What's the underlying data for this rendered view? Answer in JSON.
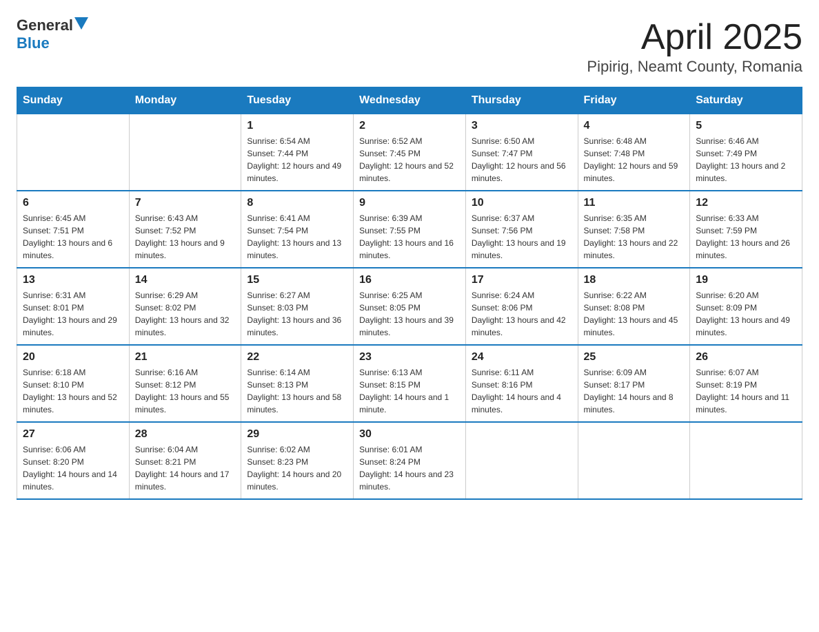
{
  "logo": {
    "text_general": "General",
    "text_blue": "Blue",
    "arrow": "▲"
  },
  "title": {
    "month_year": "April 2025",
    "location": "Pipirig, Neamt County, Romania"
  },
  "weekdays": [
    "Sunday",
    "Monday",
    "Tuesday",
    "Wednesday",
    "Thursday",
    "Friday",
    "Saturday"
  ],
  "weeks": [
    [
      {
        "day": "",
        "info": ""
      },
      {
        "day": "",
        "info": ""
      },
      {
        "day": "1",
        "info": "Sunrise: 6:54 AM\nSunset: 7:44 PM\nDaylight: 12 hours and 49 minutes."
      },
      {
        "day": "2",
        "info": "Sunrise: 6:52 AM\nSunset: 7:45 PM\nDaylight: 12 hours and 52 minutes."
      },
      {
        "day": "3",
        "info": "Sunrise: 6:50 AM\nSunset: 7:47 PM\nDaylight: 12 hours and 56 minutes."
      },
      {
        "day": "4",
        "info": "Sunrise: 6:48 AM\nSunset: 7:48 PM\nDaylight: 12 hours and 59 minutes."
      },
      {
        "day": "5",
        "info": "Sunrise: 6:46 AM\nSunset: 7:49 PM\nDaylight: 13 hours and 2 minutes."
      }
    ],
    [
      {
        "day": "6",
        "info": "Sunrise: 6:45 AM\nSunset: 7:51 PM\nDaylight: 13 hours and 6 minutes."
      },
      {
        "day": "7",
        "info": "Sunrise: 6:43 AM\nSunset: 7:52 PM\nDaylight: 13 hours and 9 minutes."
      },
      {
        "day": "8",
        "info": "Sunrise: 6:41 AM\nSunset: 7:54 PM\nDaylight: 13 hours and 13 minutes."
      },
      {
        "day": "9",
        "info": "Sunrise: 6:39 AM\nSunset: 7:55 PM\nDaylight: 13 hours and 16 minutes."
      },
      {
        "day": "10",
        "info": "Sunrise: 6:37 AM\nSunset: 7:56 PM\nDaylight: 13 hours and 19 minutes."
      },
      {
        "day": "11",
        "info": "Sunrise: 6:35 AM\nSunset: 7:58 PM\nDaylight: 13 hours and 22 minutes."
      },
      {
        "day": "12",
        "info": "Sunrise: 6:33 AM\nSunset: 7:59 PM\nDaylight: 13 hours and 26 minutes."
      }
    ],
    [
      {
        "day": "13",
        "info": "Sunrise: 6:31 AM\nSunset: 8:01 PM\nDaylight: 13 hours and 29 minutes."
      },
      {
        "day": "14",
        "info": "Sunrise: 6:29 AM\nSunset: 8:02 PM\nDaylight: 13 hours and 32 minutes."
      },
      {
        "day": "15",
        "info": "Sunrise: 6:27 AM\nSunset: 8:03 PM\nDaylight: 13 hours and 36 minutes."
      },
      {
        "day": "16",
        "info": "Sunrise: 6:25 AM\nSunset: 8:05 PM\nDaylight: 13 hours and 39 minutes."
      },
      {
        "day": "17",
        "info": "Sunrise: 6:24 AM\nSunset: 8:06 PM\nDaylight: 13 hours and 42 minutes."
      },
      {
        "day": "18",
        "info": "Sunrise: 6:22 AM\nSunset: 8:08 PM\nDaylight: 13 hours and 45 minutes."
      },
      {
        "day": "19",
        "info": "Sunrise: 6:20 AM\nSunset: 8:09 PM\nDaylight: 13 hours and 49 minutes."
      }
    ],
    [
      {
        "day": "20",
        "info": "Sunrise: 6:18 AM\nSunset: 8:10 PM\nDaylight: 13 hours and 52 minutes."
      },
      {
        "day": "21",
        "info": "Sunrise: 6:16 AM\nSunset: 8:12 PM\nDaylight: 13 hours and 55 minutes."
      },
      {
        "day": "22",
        "info": "Sunrise: 6:14 AM\nSunset: 8:13 PM\nDaylight: 13 hours and 58 minutes."
      },
      {
        "day": "23",
        "info": "Sunrise: 6:13 AM\nSunset: 8:15 PM\nDaylight: 14 hours and 1 minute."
      },
      {
        "day": "24",
        "info": "Sunrise: 6:11 AM\nSunset: 8:16 PM\nDaylight: 14 hours and 4 minutes."
      },
      {
        "day": "25",
        "info": "Sunrise: 6:09 AM\nSunset: 8:17 PM\nDaylight: 14 hours and 8 minutes."
      },
      {
        "day": "26",
        "info": "Sunrise: 6:07 AM\nSunset: 8:19 PM\nDaylight: 14 hours and 11 minutes."
      }
    ],
    [
      {
        "day": "27",
        "info": "Sunrise: 6:06 AM\nSunset: 8:20 PM\nDaylight: 14 hours and 14 minutes."
      },
      {
        "day": "28",
        "info": "Sunrise: 6:04 AM\nSunset: 8:21 PM\nDaylight: 14 hours and 17 minutes."
      },
      {
        "day": "29",
        "info": "Sunrise: 6:02 AM\nSunset: 8:23 PM\nDaylight: 14 hours and 20 minutes."
      },
      {
        "day": "30",
        "info": "Sunrise: 6:01 AM\nSunset: 8:24 PM\nDaylight: 14 hours and 23 minutes."
      },
      {
        "day": "",
        "info": ""
      },
      {
        "day": "",
        "info": ""
      },
      {
        "day": "",
        "info": ""
      }
    ]
  ]
}
